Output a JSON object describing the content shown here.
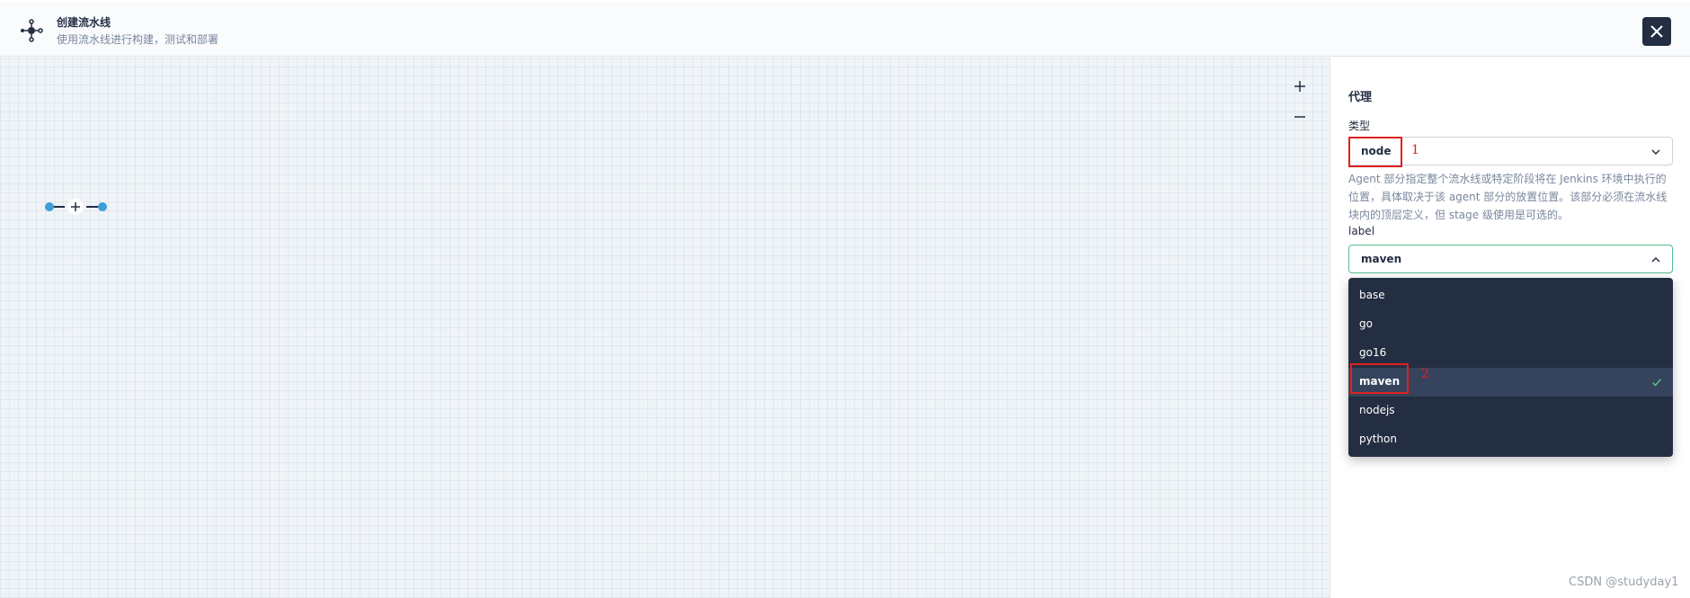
{
  "header": {
    "title": "创建流水线",
    "subtitle": "使用流水线进行构建，测试和部署",
    "icon": "pipeline-icon",
    "close_icon": "close-icon"
  },
  "canvas": {
    "zoom_in_icon": "plus-icon",
    "zoom_out_icon": "minus-icon",
    "add_stage_icon": "plus-icon"
  },
  "panel": {
    "title": "代理",
    "type_label": "类型",
    "type_value": "node",
    "description": "Agent 部分指定整个流水线或特定阶段将在 Jenkins 环境中执行的位置，具体取决于该 agent 部分的放置位置。该部分必须在流水线块内的顶层定义，但 stage 级使用是可选的。",
    "label_label": "label",
    "label_value": "maven",
    "options": [
      {
        "label": "base",
        "selected": false
      },
      {
        "label": "go",
        "selected": false
      },
      {
        "label": "go16",
        "selected": false
      },
      {
        "label": "maven",
        "selected": true
      },
      {
        "label": "nodejs",
        "selected": false
      },
      {
        "label": "python",
        "selected": false
      }
    ]
  },
  "annotations": {
    "one": "1",
    "two": "2"
  },
  "watermark": "CSDN @studyday1",
  "colors": {
    "dark": "#242e42",
    "accent_green": "#55bc8a",
    "node_blue": "#3d9ed6",
    "annotation_red": "#e02020"
  }
}
